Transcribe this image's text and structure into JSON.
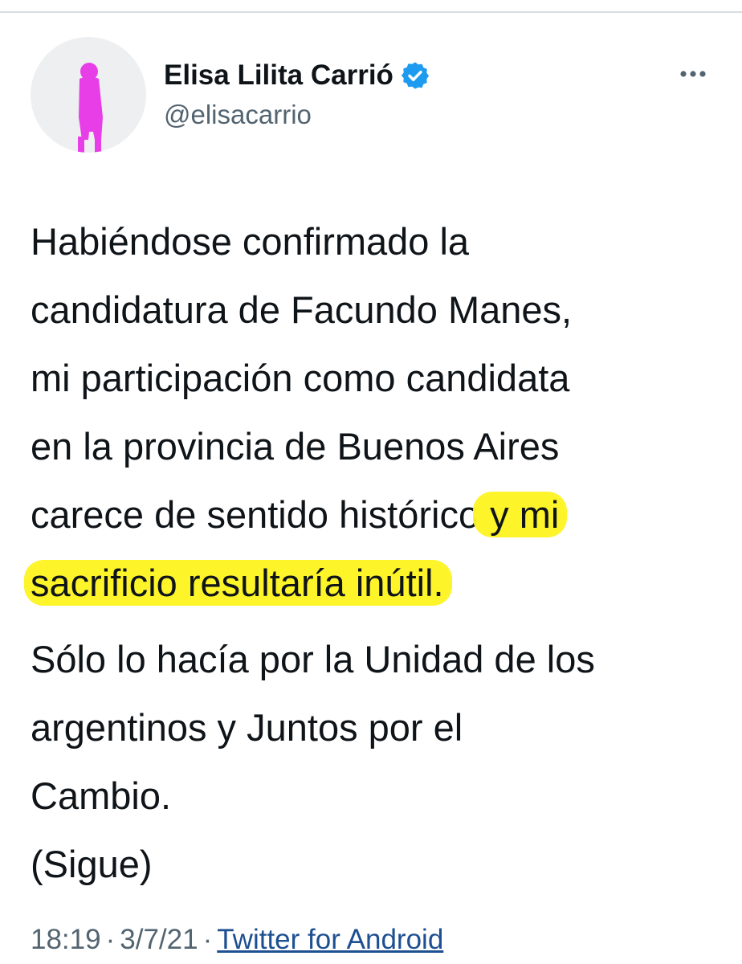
{
  "author": {
    "display_name": "Elisa Lilita Carrió",
    "handle": "@elisacarrio",
    "verified": true,
    "avatar_icon": "person-silhouette-icon",
    "avatar_color": "#e83ee8"
  },
  "menu": {
    "more_icon": "more-horizontal-icon"
  },
  "tweet": {
    "lines_p1": [
      "Habiéndose confirmado la",
      "candidatura de Facundo Manes,",
      "mi participación como candidata",
      "en la provincia de Buenos Aires"
    ],
    "line5_plain": "carece de sentido histórico",
    "line5_highlight": " y mi",
    "line6_highlight": "sacrificio resultaría inútil.",
    "lines_p2": [
      "Sólo lo hacía por la Unidad de los",
      "argentinos y Juntos por el",
      "Cambio.",
      "(Sigue)"
    ],
    "highlight_color": "#fdf42a"
  },
  "meta": {
    "time": "18:19",
    "date": "3/7/21",
    "separator": "·",
    "source": "Twitter for Android"
  },
  "colors": {
    "verified_badge": "#1d9bf0",
    "secondary_text": "#536471",
    "link": "#1d4f91"
  }
}
